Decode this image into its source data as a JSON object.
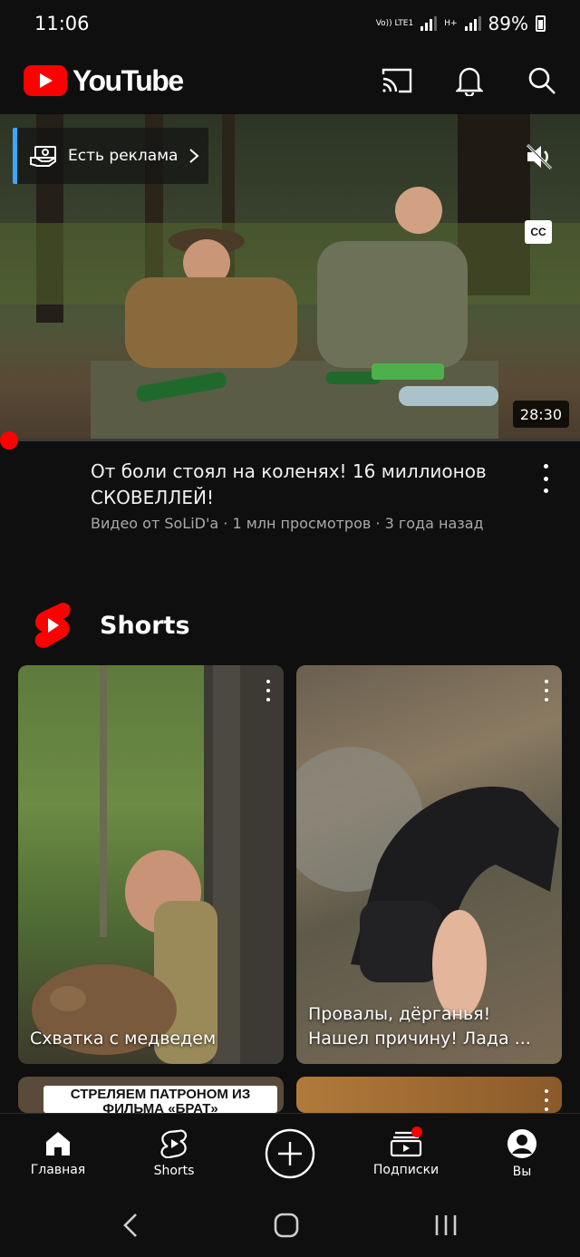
{
  "status_bar": {
    "time": "11:06",
    "network_1": "Vo)) LTE1",
    "network_2": "H+",
    "battery": "89%"
  },
  "header": {
    "app_name": "YouTube",
    "brand_color": "#ff0000",
    "icons": [
      "cast-icon",
      "bell-icon",
      "search-icon"
    ]
  },
  "player": {
    "ad_label": "Есть реклама",
    "duration": "28:30",
    "cc_label": "CC",
    "progress_fraction": 0.0
  },
  "video": {
    "title": "От боли стоял на коленях! 16 миллионов СКОВЕЛЛЕЙ!",
    "meta": "Видео от SoLiD'a · 1 млн просмотров · 3 года назад"
  },
  "shorts": {
    "section_title": "Shorts",
    "items": [
      {
        "caption": "Схватка с медведем"
      },
      {
        "caption": "Провалы, дёрганья!\nНашел причину! Лада ..."
      },
      {
        "caption": "СТРЕЛЯЕМ ПАТРОНОМ ИЗ ФИЛЬМА «БРАТ»"
      },
      {
        "caption": ""
      }
    ]
  },
  "bottom_nav": {
    "items": [
      {
        "label": "Главная",
        "icon": "home-icon"
      },
      {
        "label": "Shorts",
        "icon": "shorts-icon"
      },
      {
        "label": "",
        "icon": "create-icon"
      },
      {
        "label": "Подписки",
        "icon": "subscriptions-icon"
      },
      {
        "label": "Вы",
        "icon": "account-icon"
      }
    ]
  }
}
